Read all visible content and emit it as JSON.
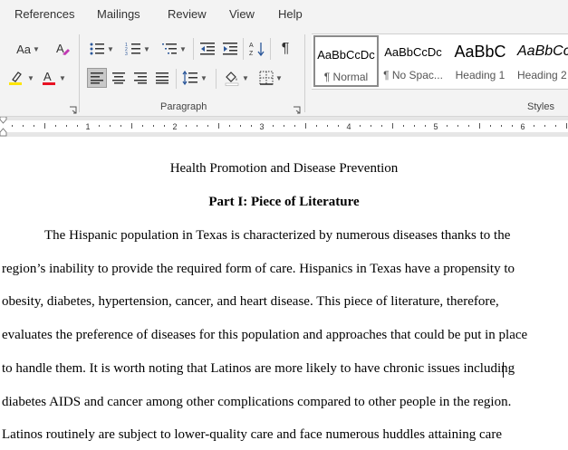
{
  "menu": {
    "tabs": [
      "References",
      "Mailings",
      "Review",
      "View",
      "Help"
    ]
  },
  "ribbon": {
    "font": {
      "change_case_label": "Aa",
      "font_color": "#e81123",
      "highlight_color": "#ffe500"
    },
    "paragraph": {
      "label": "Paragraph",
      "show_marks_glyph": "¶"
    },
    "styles": {
      "label": "Styles",
      "items": [
        {
          "sample": "AaBbCcDc",
          "name": "¶ Normal",
          "selected": true
        },
        {
          "sample": "AaBbCcDc",
          "name": "¶ No Spac...",
          "selected": false
        },
        {
          "sample": "AaBbC",
          "name": "Heading 1",
          "selected": false
        },
        {
          "sample": "AaBbCc",
          "name": "Heading 2",
          "selected": false
        }
      ]
    }
  },
  "ruler": {
    "numbers": [
      "1",
      "2",
      "3",
      "4",
      "5",
      "6"
    ]
  },
  "document": {
    "title": "Health Promotion and Disease Prevention",
    "heading": "Part I: Piece of Literature",
    "lines": [
      "The Hispanic population in Texas is characterized by numerous diseases thanks to the",
      "region’s inability to provide the required form of care. Hispanics in Texas have a propensity to",
      "obesity, diabetes, hypertension, cancer, and heart disease. This piece of literature, therefore,",
      "evaluates the preference of diseases for this population and approaches that could be put in place",
      "to handle them. It is worth noting that Latinos are more likely to have chronic issues including",
      "diabetes AIDS and cancer among other complications compared to other people in the region.",
      "Latinos routinely are subject to lower-quality care and face numerous huddles attaining care"
    ]
  }
}
